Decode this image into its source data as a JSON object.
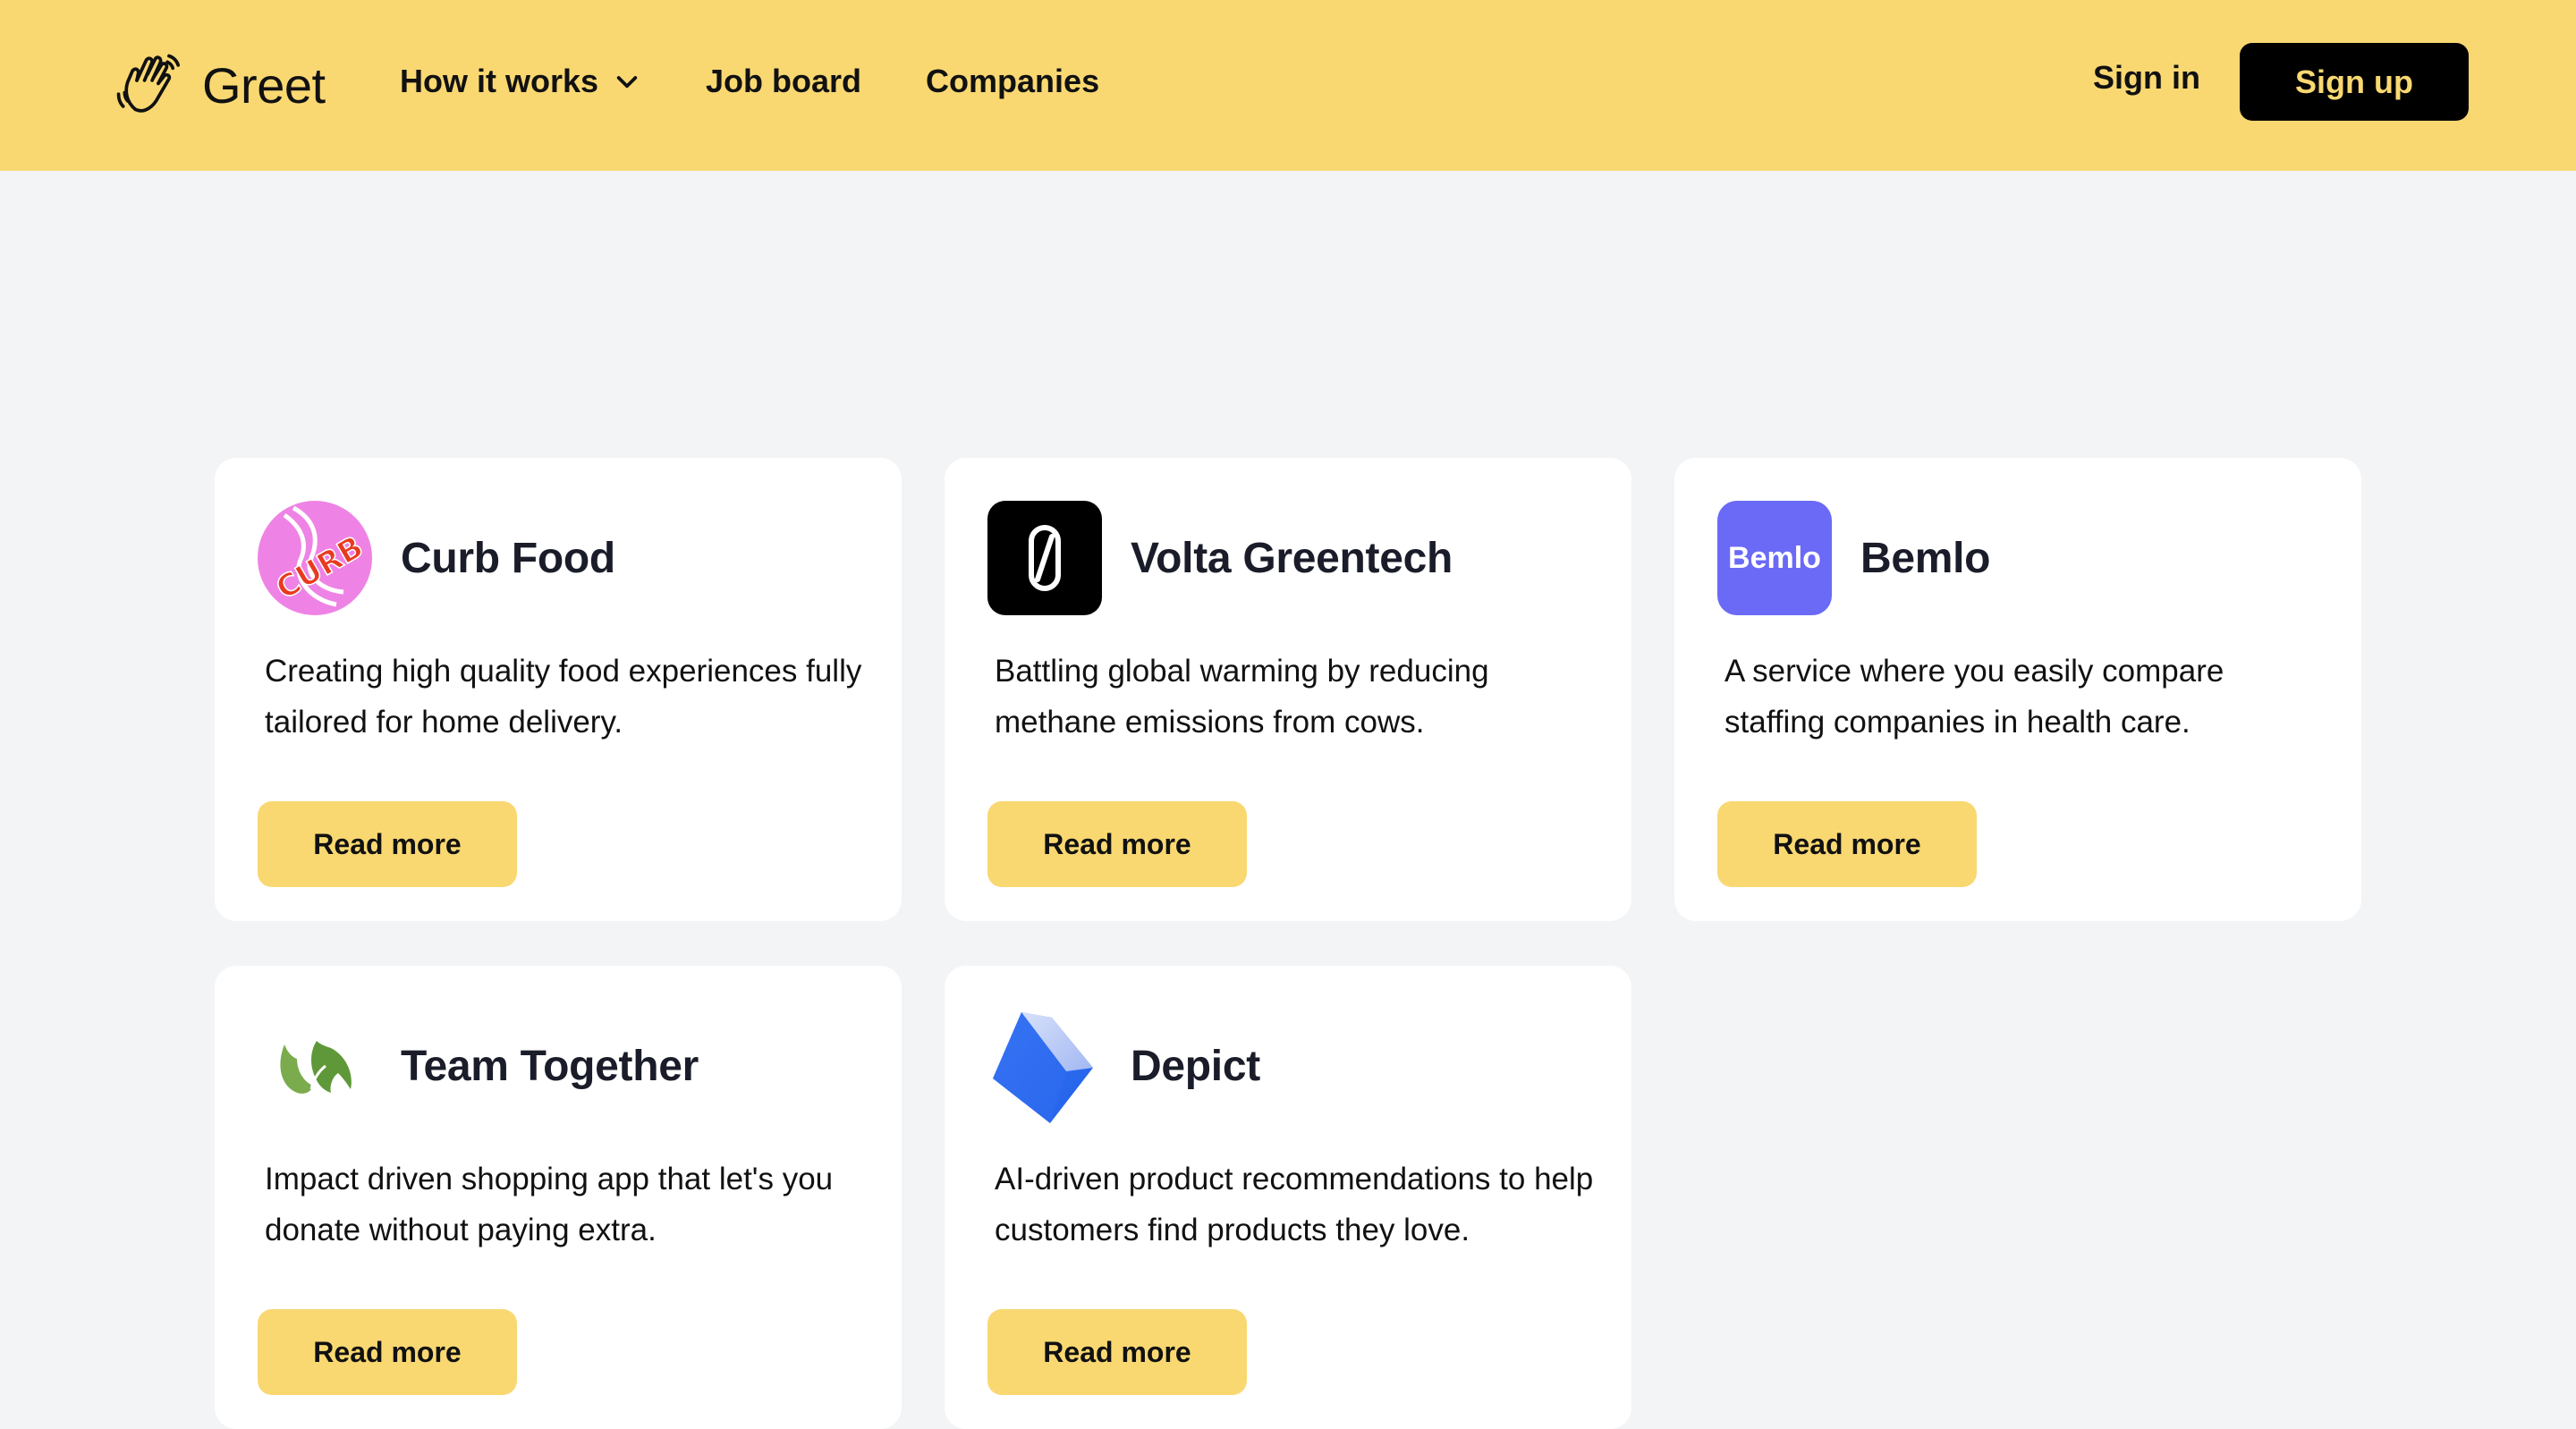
{
  "header": {
    "brand": "Greet",
    "brand_icon": "waving-hand-icon",
    "nav": [
      {
        "label": "How it works",
        "has_dropdown": true
      },
      {
        "label": "Job board"
      },
      {
        "label": "Companies"
      }
    ],
    "sign_in": "Sign in",
    "sign_up": "Sign up"
  },
  "colors": {
    "header_bg": "#f9d872",
    "page_bg": "#f3f4f6",
    "button_yellow": "#f9d872",
    "signup_bg": "#000000",
    "signup_text": "#f9d872"
  },
  "companies": [
    {
      "name": "Curb Food",
      "logo": "curb-food-logo",
      "logo_text": "CURB",
      "description": "Creating high quality food experiences fully tailored for home delivery.",
      "cta": "Read more"
    },
    {
      "name": "Volta Greentech",
      "logo": "volta-greentech-logo",
      "logo_text": "0",
      "description": "Battling global warming by reducing methane emissions from cows.",
      "cta": "Read more"
    },
    {
      "name": "Bemlo",
      "logo": "bemlo-logo",
      "logo_text": "Bemlo",
      "description": "A service where you easily compare staffing companies in health care.",
      "cta": "Read more"
    },
    {
      "name": "Team Together",
      "logo": "team-together-logo",
      "description": "Impact driven shopping app that let's you donate without paying extra.",
      "cta": "Read more"
    },
    {
      "name": "Depict",
      "logo": "depict-logo",
      "description": "AI-driven product recommendations to help customers find products they love.",
      "cta": "Read more"
    }
  ]
}
